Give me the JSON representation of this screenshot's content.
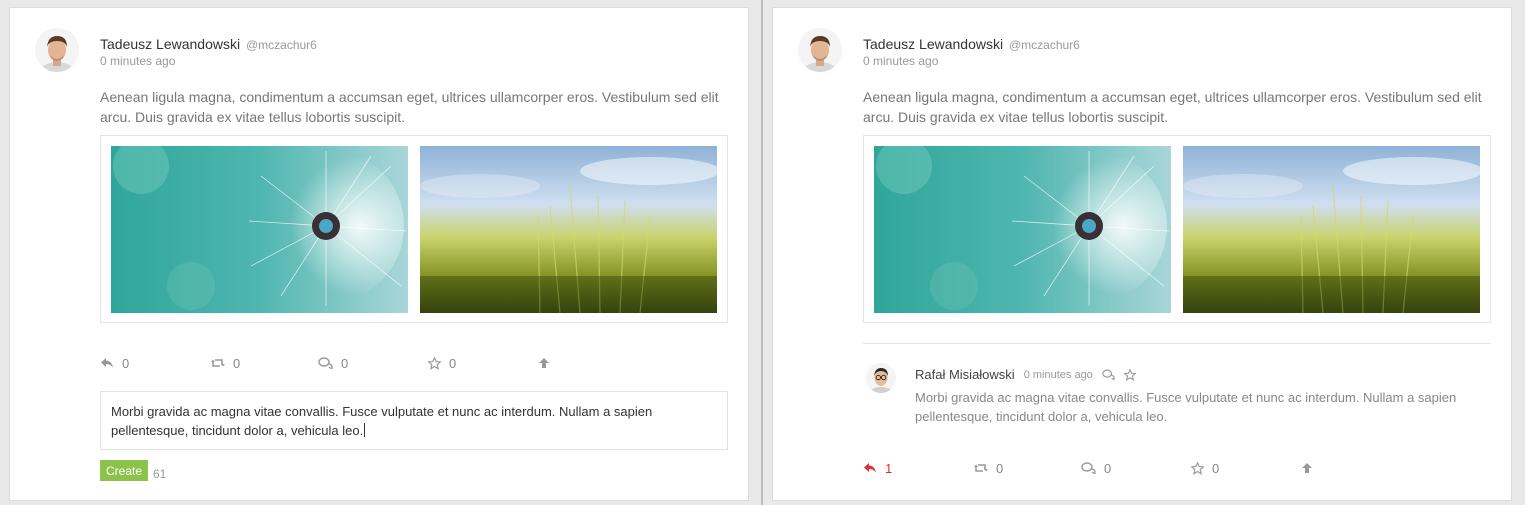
{
  "left_post": {
    "author_name": "Tadeusz Lewandowski",
    "author_handle": "@mczachur6",
    "time": "0 minutes ago",
    "body": "Aenean ligula magna, condimentum a accumsan eget, ultrices ullamcorper eros. Vestibulum sed elit arcu. Duis gravida ex vitae tellus lobortis suscipit.",
    "images": [
      {
        "icon": "dandelion-photo"
      },
      {
        "icon": "wheat-field-photo"
      }
    ],
    "actions": {
      "reply": {
        "icon": "reply-icon",
        "count": "0"
      },
      "retweet": {
        "icon": "retweet-icon",
        "count": "0"
      },
      "comments": {
        "icon": "comments-icon",
        "count": "0"
      },
      "favorite": {
        "icon": "star-icon",
        "count": "0"
      },
      "upvote": {
        "icon": "arrow-up-icon"
      }
    },
    "comment_input": {
      "value": "Morbi gravida ac magna vitae convallis. Fusce vulputate et nunc ac interdum. Nullam a sapien pellentesque, tincidunt dolor a, vehicula leo."
    },
    "create_label": "Create",
    "char_count": "61"
  },
  "right_post": {
    "author_name": "Tadeusz Lewandowski",
    "author_handle": "@mczachur6",
    "time": "0 minutes ago",
    "body": "Aenean ligula magna, condimentum a accumsan eget, ultrices ullamcorper eros. Vestibulum sed elit arcu. Duis gravida ex vitae tellus lobortis suscipit.",
    "comment": {
      "author_name": "Rafał Misiałowski",
      "time": "0 minutes ago",
      "body": "Morbi gravida ac magna vitae convallis. Fusce vulputate et nunc ac interdum. Nullam a sapien pellentesque, tincidunt dolor a, vehicula leo."
    },
    "actions": {
      "reply": {
        "icon": "reply-icon",
        "count": "1",
        "active": true
      },
      "retweet": {
        "icon": "retweet-icon",
        "count": "0"
      },
      "comments": {
        "icon": "comments-icon",
        "count": "0"
      },
      "favorite": {
        "icon": "star-icon",
        "count": "0"
      },
      "upvote": {
        "icon": "arrow-up-icon"
      }
    }
  },
  "colors": {
    "create_button": "#8bc34a",
    "active_reply": "#e23030",
    "text_muted": "#999999"
  }
}
